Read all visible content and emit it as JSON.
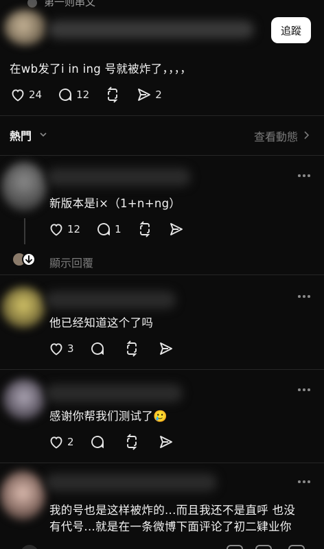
{
  "top_post": {
    "header_fragment": "第一则串文",
    "follow_label": "追蹤",
    "text": "在wb发了i in ing 号就被炸了，，，，",
    "likes": "24",
    "comments": "12",
    "shares": "2"
  },
  "sort_bar": {
    "label": "熱門",
    "view_activity": "查看動態"
  },
  "replies": [
    {
      "text": "新版本是i×（1+n+ng）",
      "likes": "12",
      "comments": "1",
      "show_replies": "顯示回覆"
    },
    {
      "text": "他已经知道这个了吗",
      "likes": "3"
    },
    {
      "text": "感谢你帮我们测试了🥲",
      "likes": "2"
    },
    {
      "text_line1": "我的号也是这样被炸的...而且我还不是直呼 也没",
      "text_line2": "有代号...就是在一条微博下面评论了初二肄业你"
    }
  ],
  "colors": {
    "background": "#0c0c0c",
    "text": "#f2f2f2",
    "muted": "#7a7a7a",
    "divider": "#262626"
  }
}
